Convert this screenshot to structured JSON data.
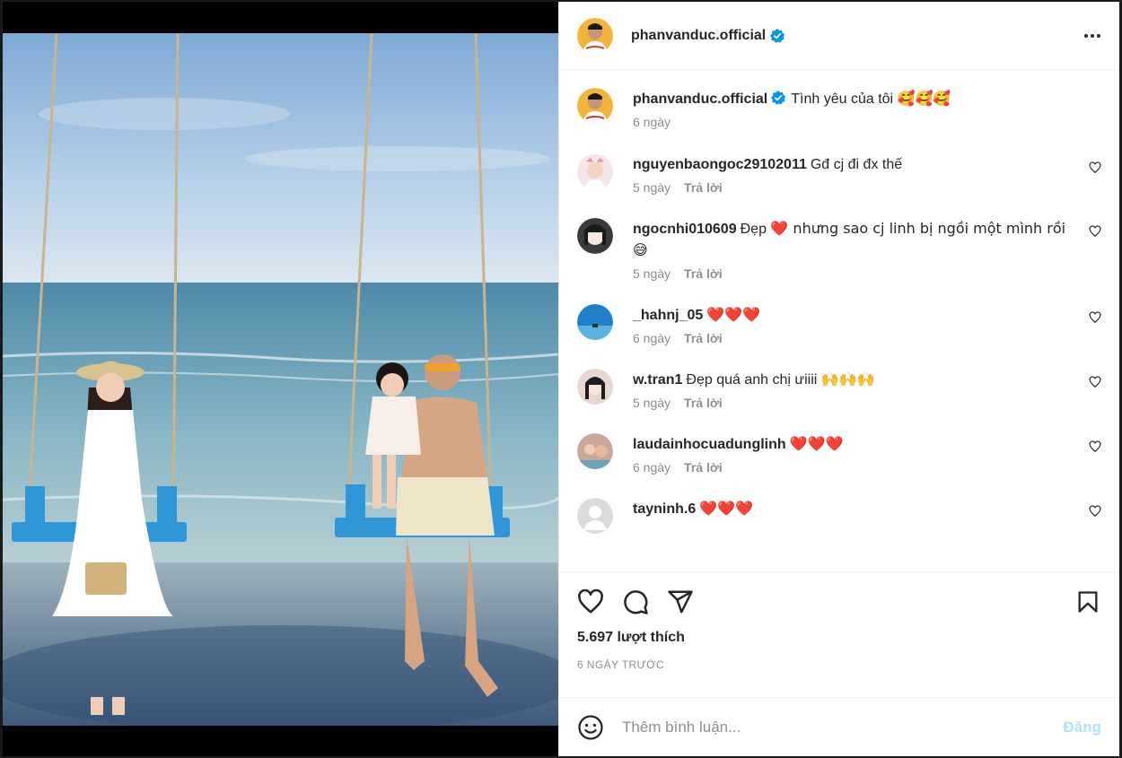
{
  "post": {
    "username": "phanvanduc.official",
    "caption": "Tình yêu của tôi",
    "caption_emojis": "🥰🥰🥰",
    "caption_time": "6 ngày",
    "likes": "5.697 lượt thích",
    "posted": "6 NGÀY TRƯỚC"
  },
  "comments": [
    {
      "user": "nguyenbaongoc29102011",
      "text": "Gđ cj đi đx thế",
      "emojis": "",
      "time": "5 ngày",
      "reply": "Trả lời",
      "avatar_color": "#f3e5e8"
    },
    {
      "user": "ngocnhi010609",
      "text": "Đẹp",
      "emojis": "❤️ nhưng sao cj linh bị ngồi một mình rồi 😅",
      "time": "5 ngày",
      "reply": "Trả lời",
      "avatar_color": "#3a3a3a"
    },
    {
      "user": "_hahnj_05",
      "text": "",
      "emojis": "❤️❤️❤️",
      "time": "6 ngày",
      "reply": "Trả lời",
      "avatar_color": "#1f7fc8"
    },
    {
      "user": "w.tran1",
      "text": "Đẹp quá anh chị ưiiii",
      "emojis": "🙌🙌🙌",
      "time": "5 ngày",
      "reply": "Trả lời",
      "avatar_color": "#e8d6d0"
    },
    {
      "user": "laudainhocuadunglinh",
      "text": "",
      "emojis": "❤️❤️❤️",
      "time": "6 ngày",
      "reply": "Trả lời",
      "avatar_color": "#c9a89a"
    },
    {
      "user": "tayninh.6",
      "text": "",
      "emojis": "❤️❤️❤️",
      "time": "",
      "reply": "",
      "avatar_color": "#dbdbdb"
    }
  ],
  "input": {
    "placeholder": "Thêm bình luận...",
    "post_label": "Đăng"
  },
  "icons": [
    "more-icon",
    "verified-icon",
    "heart-icon",
    "comment-icon",
    "share-icon",
    "bookmark-icon",
    "smile-icon"
  ],
  "colors": {
    "accent": "#0095f6",
    "post_disabled": "#b2dffc",
    "muted": "#8e8e8e",
    "heart": "#e0202c"
  }
}
